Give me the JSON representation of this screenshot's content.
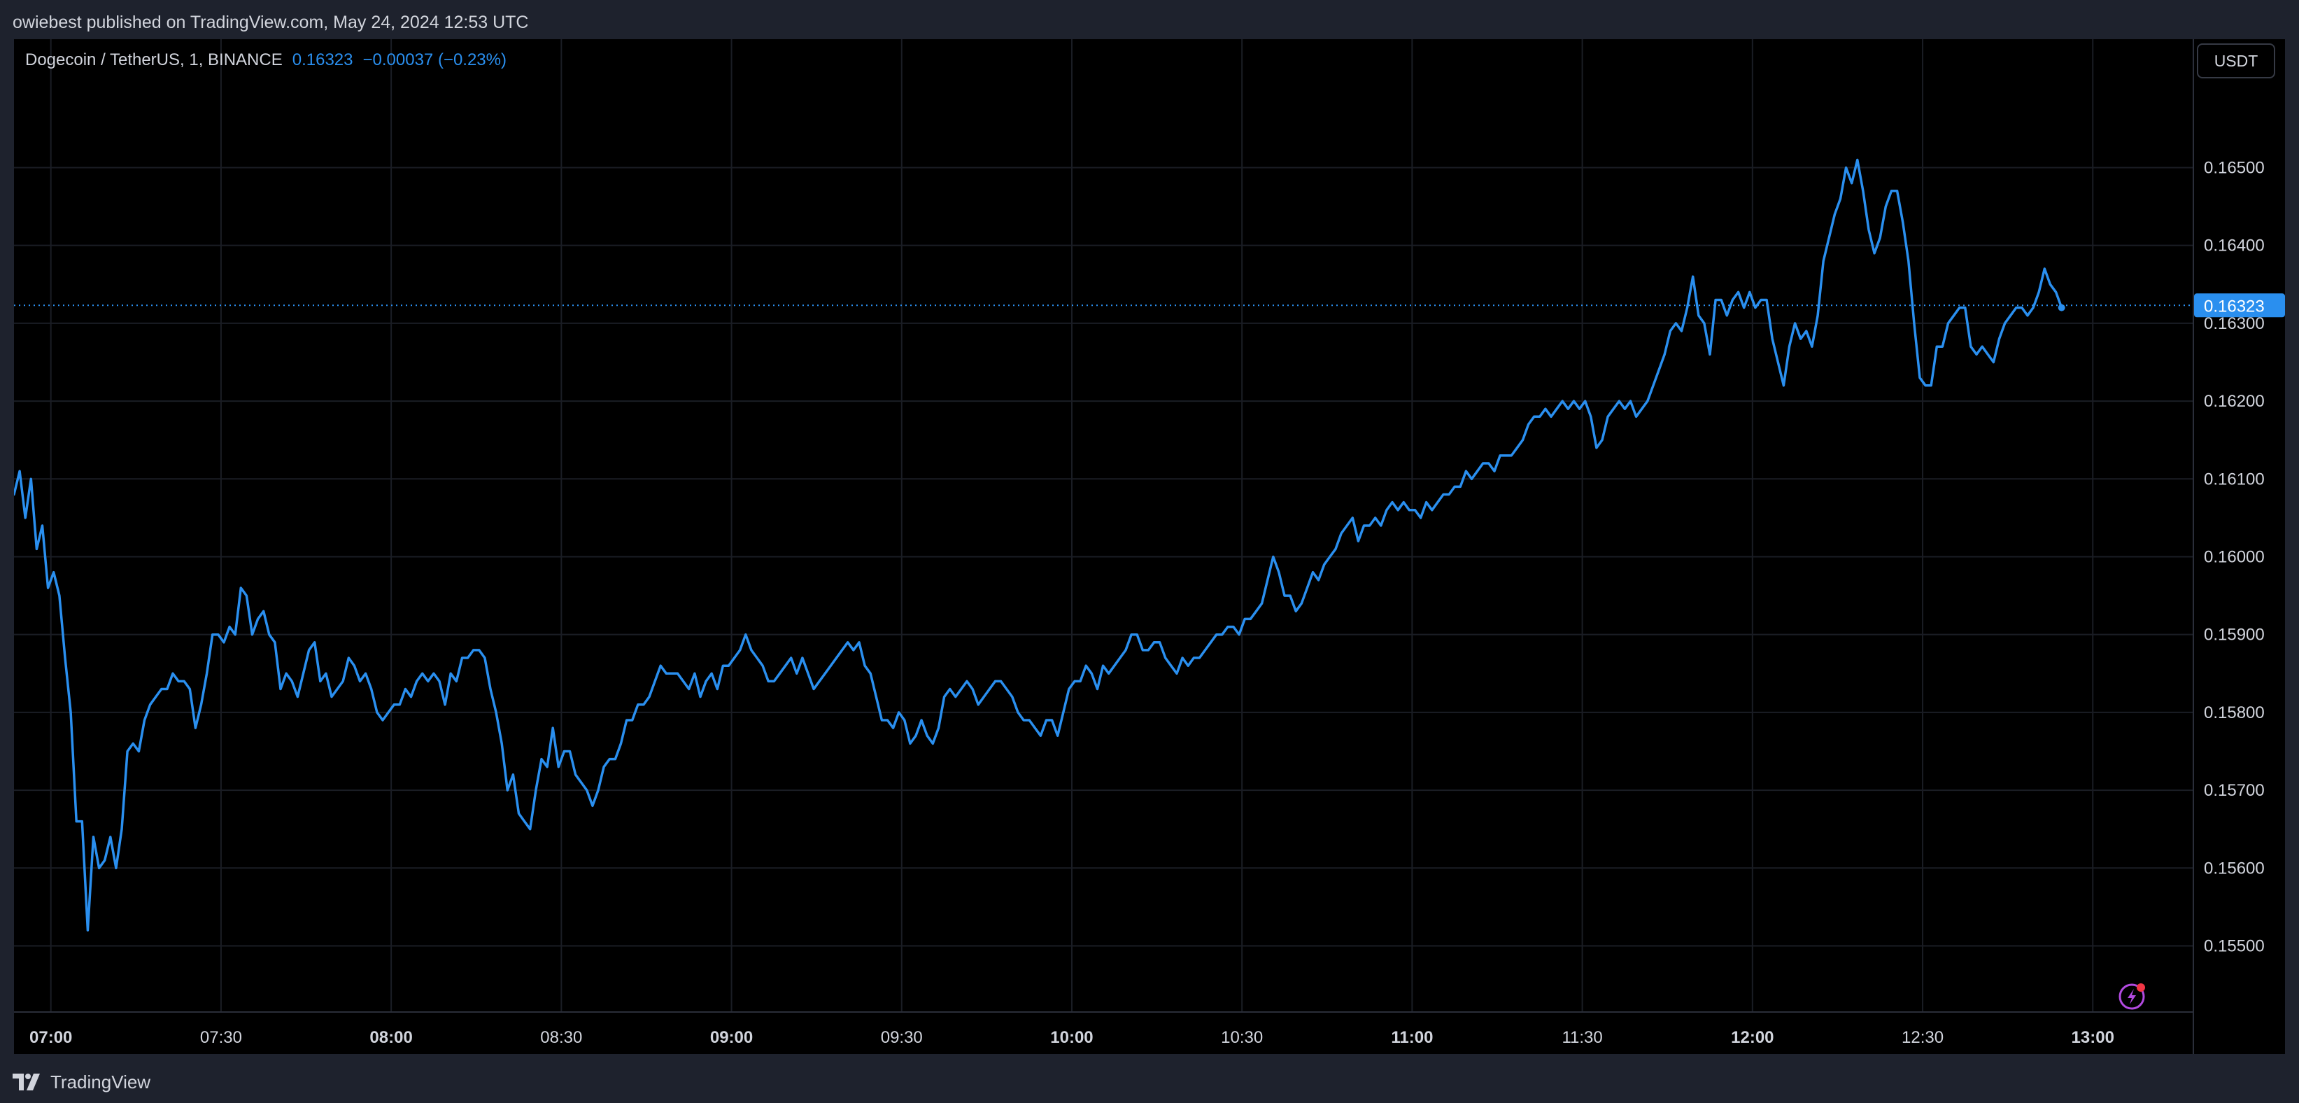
{
  "header": {
    "attribution": "owiebest published on TradingView.com, May 24, 2024 12:53 UTC"
  },
  "legend": {
    "symbol": "Dogecoin / TetherUS, 1, BINANCE",
    "price": "0.16323",
    "change": "−0.00037 (−0.23%)"
  },
  "currency_button": {
    "label": "USDT"
  },
  "footer": {
    "brand": "TradingView"
  },
  "colors": {
    "line": "#2a8fef",
    "background": "#000000",
    "grid": "#1a1d24",
    "axis_text": "#d1d4dc",
    "price_tag": "#2a8fef"
  },
  "chart_data": {
    "type": "line",
    "title": "",
    "xlabel": "",
    "ylabel": "",
    "grid": true,
    "x_ticks": [
      {
        "label": "07:00",
        "t": 60,
        "bold": true
      },
      {
        "label": "07:30",
        "t": 90,
        "bold": false
      },
      {
        "label": "08:00",
        "t": 120,
        "bold": true
      },
      {
        "label": "08:30",
        "t": 150,
        "bold": false
      },
      {
        "label": "09:00",
        "t": 180,
        "bold": true
      },
      {
        "label": "09:30",
        "t": 210,
        "bold": false
      },
      {
        "label": "10:00",
        "t": 240,
        "bold": true
      },
      {
        "label": "10:30",
        "t": 270,
        "bold": false
      },
      {
        "label": "11:00",
        "t": 300,
        "bold": true
      },
      {
        "label": "11:30",
        "t": 330,
        "bold": false
      },
      {
        "label": "12:00",
        "t": 360,
        "bold": true
      },
      {
        "label": "12:30",
        "t": 390,
        "bold": false
      },
      {
        "label": "13:00",
        "t": 420,
        "bold": true
      }
    ],
    "y_ticks": [
      "0.15500",
      "0.15600",
      "0.15700",
      "0.15800",
      "0.15900",
      "0.16000",
      "0.16100",
      "0.16200",
      "0.16300",
      "0.16400",
      "0.16500"
    ],
    "ylim": [
      0.15415,
      0.16665
    ],
    "xlim_minutes": [
      53.5,
      427.0
    ],
    "last_price": {
      "label": "0.16323",
      "value": 0.16323
    },
    "series": [
      {
        "x_start_minutes": 53.5,
        "x_step_minutes": 1,
        "values": [
          0.1608,
          0.1611,
          0.1605,
          0.161,
          0.1601,
          0.1604,
          0.1596,
          0.1598,
          0.1595,
          0.1587,
          0.158,
          0.1566,
          0.1566,
          0.1552,
          0.1564,
          0.156,
          0.1561,
          0.1564,
          0.156,
          0.1565,
          0.1575,
          0.1576,
          0.1575,
          0.1579,
          0.1581,
          0.1582,
          0.1583,
          0.1583,
          0.1585,
          0.1584,
          0.1584,
          0.1583,
          0.1578,
          0.1581,
          0.1585,
          0.159,
          0.159,
          0.1589,
          0.1591,
          0.159,
          0.1596,
          0.1595,
          0.159,
          0.1592,
          0.1593,
          0.159,
          0.1589,
          0.1583,
          0.1585,
          0.1584,
          0.1582,
          0.1585,
          0.1588,
          0.1589,
          0.1584,
          0.1585,
          0.1582,
          0.1583,
          0.1584,
          0.1587,
          0.1586,
          0.1584,
          0.1585,
          0.1583,
          0.158,
          0.1579,
          0.158,
          0.1581,
          0.1581,
          0.1583,
          0.1582,
          0.1584,
          0.1585,
          0.1584,
          0.1585,
          0.1584,
          0.1581,
          0.1585,
          0.1584,
          0.1587,
          0.1587,
          0.1588,
          0.1588,
          0.1587,
          0.1583,
          0.158,
          0.1576,
          0.157,
          0.1572,
          0.1567,
          0.1566,
          0.1565,
          0.157,
          0.1574,
          0.1573,
          0.1578,
          0.1573,
          0.1575,
          0.1575,
          0.1572,
          0.1571,
          0.157,
          0.1568,
          0.157,
          0.1573,
          0.1574,
          0.1574,
          0.1576,
          0.1579,
          0.1579,
          0.1581,
          0.1581,
          0.1582,
          0.1584,
          0.1586,
          0.1585,
          0.1585,
          0.1585,
          0.1584,
          0.1583,
          0.1585,
          0.1582,
          0.1584,
          0.1585,
          0.1583,
          0.1586,
          0.1586,
          0.1587,
          0.1588,
          0.159,
          0.1588,
          0.1587,
          0.1586,
          0.1584,
          0.1584,
          0.1585,
          0.1586,
          0.1587,
          0.1585,
          0.1587,
          0.1585,
          0.1583,
          0.1584,
          0.1585,
          0.1586,
          0.1587,
          0.1588,
          0.1589,
          0.1588,
          0.1589,
          0.1586,
          0.1585,
          0.1582,
          0.1579,
          0.1579,
          0.1578,
          0.158,
          0.1579,
          0.1576,
          0.1577,
          0.1579,
          0.1577,
          0.1576,
          0.1578,
          0.1582,
          0.1583,
          0.1582,
          0.1583,
          0.1584,
          0.1583,
          0.1581,
          0.1582,
          0.1583,
          0.1584,
          0.1584,
          0.1583,
          0.1582,
          0.158,
          0.1579,
          0.1579,
          0.1578,
          0.1577,
          0.1579,
          0.1579,
          0.1577,
          0.158,
          0.1583,
          0.1584,
          0.1584,
          0.1586,
          0.1585,
          0.1583,
          0.1586,
          0.1585,
          0.1586,
          0.1587,
          0.1588,
          0.159,
          0.159,
          0.1588,
          0.1588,
          0.1589,
          0.1589,
          0.1587,
          0.1586,
          0.1585,
          0.1587,
          0.1586,
          0.1587,
          0.1587,
          0.1588,
          0.1589,
          0.159,
          0.159,
          0.1591,
          0.1591,
          0.159,
          0.1592,
          0.1592,
          0.1593,
          0.1594,
          0.1597,
          0.16,
          0.1598,
          0.1595,
          0.1595,
          0.1593,
          0.1594,
          0.1596,
          0.1598,
          0.1597,
          0.1599,
          0.16,
          0.1601,
          0.1603,
          0.1604,
          0.1605,
          0.1602,
          0.1604,
          0.1604,
          0.1605,
          0.1604,
          0.1606,
          0.1607,
          0.1606,
          0.1607,
          0.1606,
          0.1606,
          0.1605,
          0.1607,
          0.1606,
          0.1607,
          0.1608,
          0.1608,
          0.1609,
          0.1609,
          0.1611,
          0.161,
          0.1611,
          0.1612,
          0.1612,
          0.1611,
          0.1613,
          0.1613,
          0.1613,
          0.1614,
          0.1615,
          0.1617,
          0.1618,
          0.1618,
          0.1619,
          0.1618,
          0.1619,
          0.162,
          0.1619,
          0.162,
          0.1619,
          0.162,
          0.1618,
          0.1614,
          0.1615,
          0.1618,
          0.1619,
          0.162,
          0.1619,
          0.162,
          0.1618,
          0.1619,
          0.162,
          0.1622,
          0.1624,
          0.1626,
          0.1629,
          0.163,
          0.1629,
          0.1632,
          0.1636,
          0.1631,
          0.163,
          0.1626,
          0.1633,
          0.1633,
          0.1631,
          0.1633,
          0.1634,
          0.1632,
          0.1634,
          0.1632,
          0.1633,
          0.1633,
          0.1628,
          0.1625,
          0.1622,
          0.1627,
          0.163,
          0.1628,
          0.1629,
          0.1627,
          0.1631,
          0.1638,
          0.1641,
          0.1644,
          0.1646,
          0.165,
          0.1648,
          0.1651,
          0.1647,
          0.1642,
          0.1639,
          0.1641,
          0.1645,
          0.1647,
          0.1647,
          0.1643,
          0.1638,
          0.163,
          0.1623,
          0.1622,
          0.1622,
          0.1627,
          0.1627,
          0.163,
          0.1631,
          0.1632,
          0.1632,
          0.1627,
          0.1626,
          0.1627,
          0.1626,
          0.1625,
          0.1628,
          0.163,
          0.1631,
          0.1632,
          0.1632,
          0.1631,
          0.1632,
          0.1634,
          0.1637,
          0.1635,
          0.1634,
          0.1632
        ]
      }
    ]
  }
}
